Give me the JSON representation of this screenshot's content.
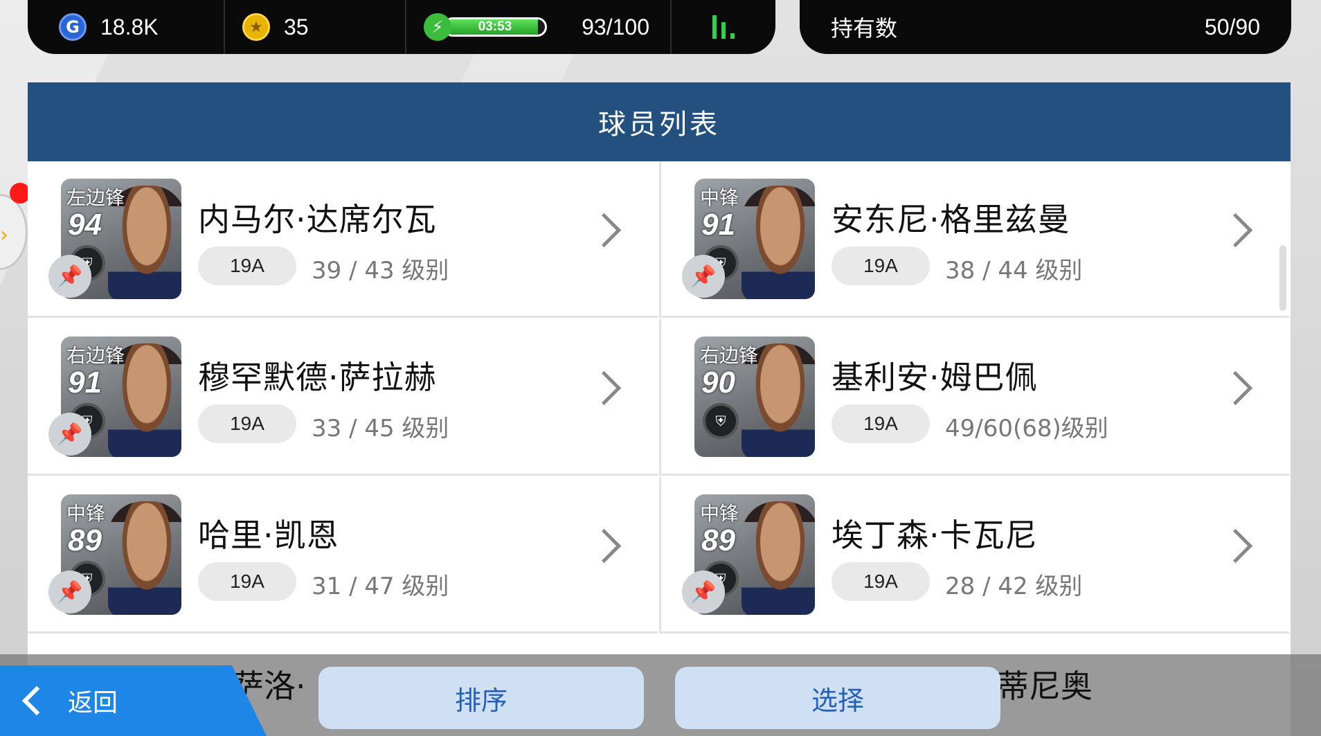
{
  "status": {
    "gp": "18.8K",
    "coins": "35",
    "energy_timer": "03:53",
    "energy_fill": 0.93,
    "energy": "93/100",
    "owned_label": "持有数",
    "owned_value": "50/90"
  },
  "panel": {
    "title": "球员列表"
  },
  "players": [
    {
      "position": "左边锋",
      "rating": "94",
      "name": "内马尔·达席尔瓦",
      "version": "19A",
      "level": "39 / 43 级别"
    },
    {
      "position": "中锋",
      "rating": "91",
      "name": "安东尼·格里兹曼",
      "version": "19A",
      "level": "38 / 44 级别"
    },
    {
      "position": "右边锋",
      "rating": "91",
      "name": "穆罕默德·萨拉赫",
      "version": "19A",
      "level": "33 / 45 级别"
    },
    {
      "position": "右边锋",
      "rating": "90",
      "name": "基利安·姆巴佩",
      "version": "19A",
      "level": "49/60(68)级别"
    },
    {
      "position": "中锋",
      "rating": "89",
      "name": "哈里·凯恩",
      "version": "19A",
      "level": "31 / 47 级别"
    },
    {
      "position": "中锋",
      "rating": "89",
      "name": "埃丁森·卡瓦尼",
      "version": "19A",
      "level": "28 / 42 级别"
    }
  ],
  "partial": {
    "left_name": "萨洛·",
    "right_name": "蒂尼奥"
  },
  "buttons": {
    "back": "返回",
    "sort": "排序",
    "select": "选择"
  },
  "colors": {
    "header": "#23507f",
    "back_button": "#1e86e6",
    "pill_button": "#cfe0f4",
    "energy_green": "#3cbc3c"
  }
}
